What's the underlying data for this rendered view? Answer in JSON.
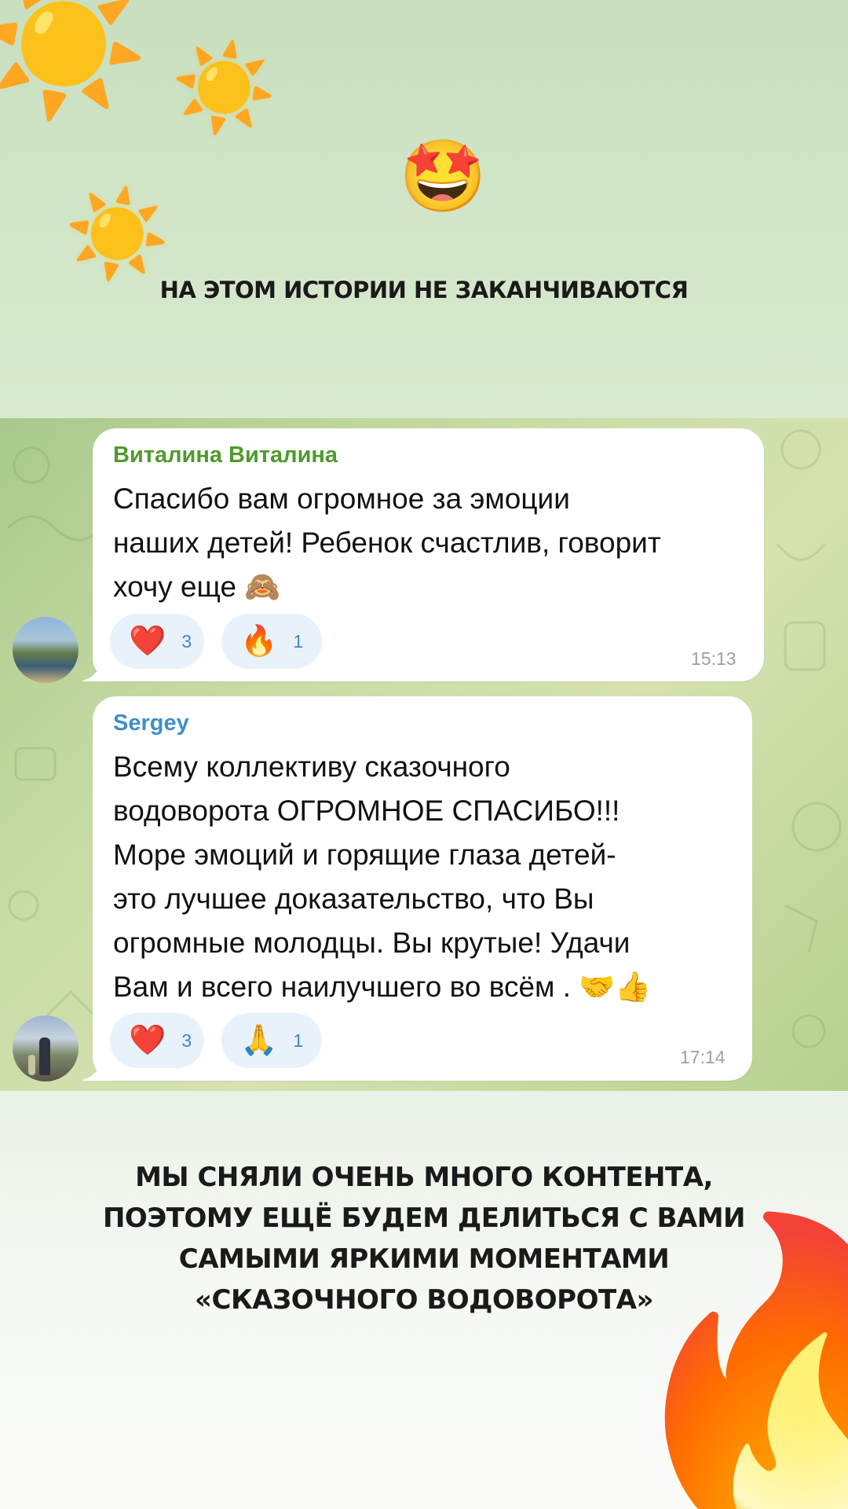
{
  "story": {
    "headline_top": "НА ЭТОМ ИСТОРИИ НЕ ЗАКАНЧИВАЮТСЯ",
    "headline_bottom": [
      "МЫ СНЯЛИ ОЧЕНЬ МНОГО КОНТЕНТА,",
      "ПОЭТОМУ ЕЩЁ БУДЕМ ДЕЛИТЬСЯ С ВАМИ",
      "САМЫМИ ЯРКИМИ МОМЕНТАМИ",
      "«СКАЗОЧНОГО ВОДОВОРОТА»"
    ],
    "stickers": {
      "sun_large": "☀️",
      "sun_medium": "☀️",
      "sun_small": "☀️",
      "star_struck": "🤩",
      "fire": "🔥"
    }
  },
  "chat": {
    "messages": [
      {
        "sender": "Виталина Виталина",
        "text": "Спасибо вам огромное за эмоции\nнаших детей! Ребенок счастлив, говорит\nхочу еще 🙈",
        "reactions": [
          {
            "emoji": "❤️",
            "count": "3"
          },
          {
            "emoji": "🔥",
            "count": "1"
          }
        ],
        "time": "15:13",
        "sender_color": "#4f9a2b"
      },
      {
        "sender": "Sergey",
        "text": "Всему коллективу сказочного\nводоворота ОГРОМНОЕ СПАСИБО!!!\nМоре эмоций и горящие глаза детей-\nэто лучшее доказательство, что Вы\nогромные молодцы. Вы крутые! Удачи\nВам и всего наилучшего во всём . 🤝👍",
        "reactions": [
          {
            "emoji": "❤️",
            "count": "3"
          },
          {
            "emoji": "🙏",
            "count": "1"
          }
        ],
        "time": "17:14",
        "sender_color": "#3f8fc9"
      }
    ],
    "reaction_bg": "#e8f2fb",
    "count_color": "#3e86c4"
  }
}
